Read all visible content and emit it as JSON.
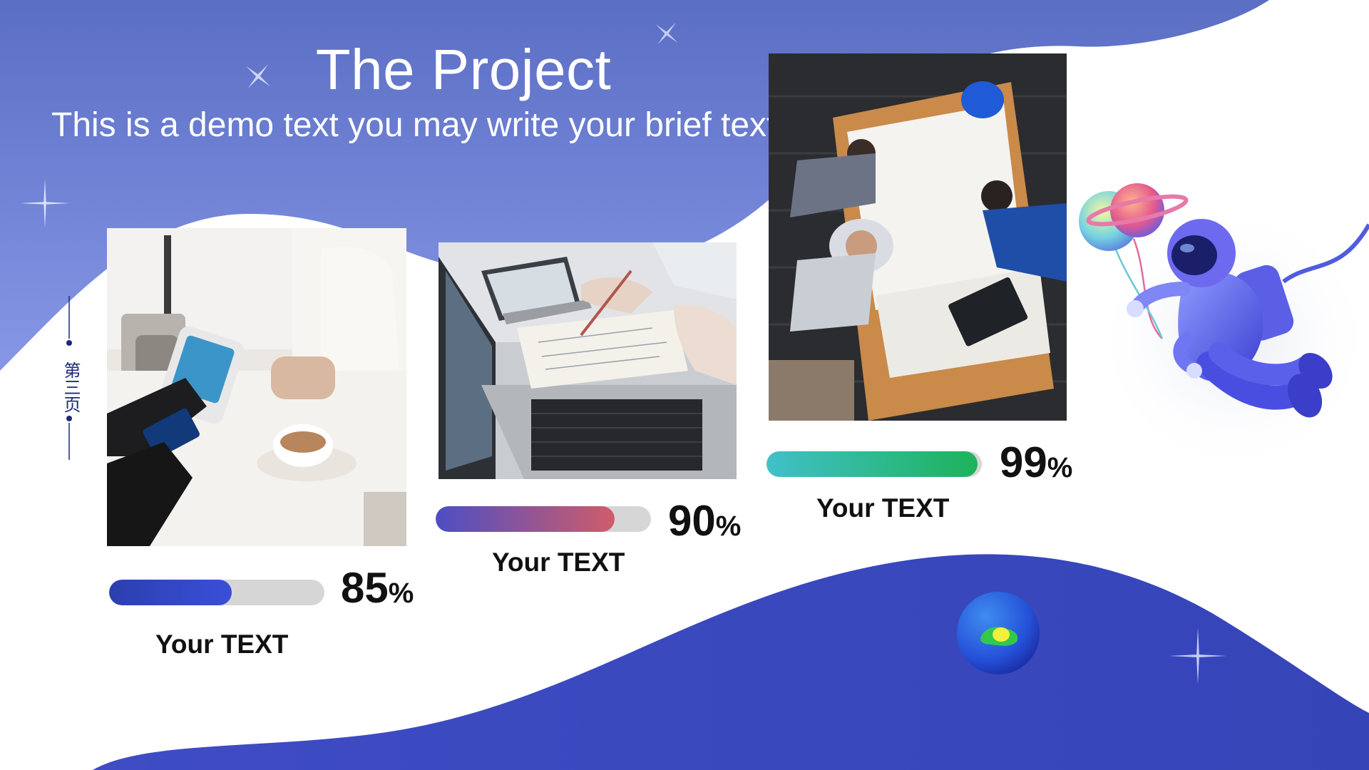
{
  "header": {
    "title": "The Project",
    "subtitle": "This is a demo text you may write your brief text here"
  },
  "page_tag": {
    "text": "第三页"
  },
  "items": [
    {
      "caption": "Your TEXT",
      "percent": 85,
      "percent_number": "85",
      "percent_symbol": "%",
      "bar_colors": [
        "#2b3fae",
        "#3a4fd8"
      ],
      "photo_icon": "coffee-payment-photo"
    },
    {
      "caption": "Your TEXT",
      "percent": 90,
      "percent_number": "90",
      "percent_symbol": "%",
      "bar_colors": [
        "#4c4ec4",
        "#d05c6a"
      ],
      "photo_icon": "laptop-writing-photo"
    },
    {
      "caption": "Your TEXT",
      "percent": 99,
      "percent_number": "99",
      "percent_symbol": "%",
      "bar_colors": [
        "#41c0c9",
        "#1db35a"
      ],
      "photo_icon": "team-meeting-photo"
    }
  ],
  "colors": {
    "top_wave_start": "#5a6ec4",
    "top_wave_end": "#8191e3",
    "bottom_wave": "#3d4bc2",
    "bar_track": "#d6d6d6",
    "text_dark": "#111111"
  },
  "decor": {
    "astronaut_icon": "astronaut-illustration",
    "globe_icon": "globe-illustration",
    "sparkle_icon": "sparkle-icon"
  }
}
